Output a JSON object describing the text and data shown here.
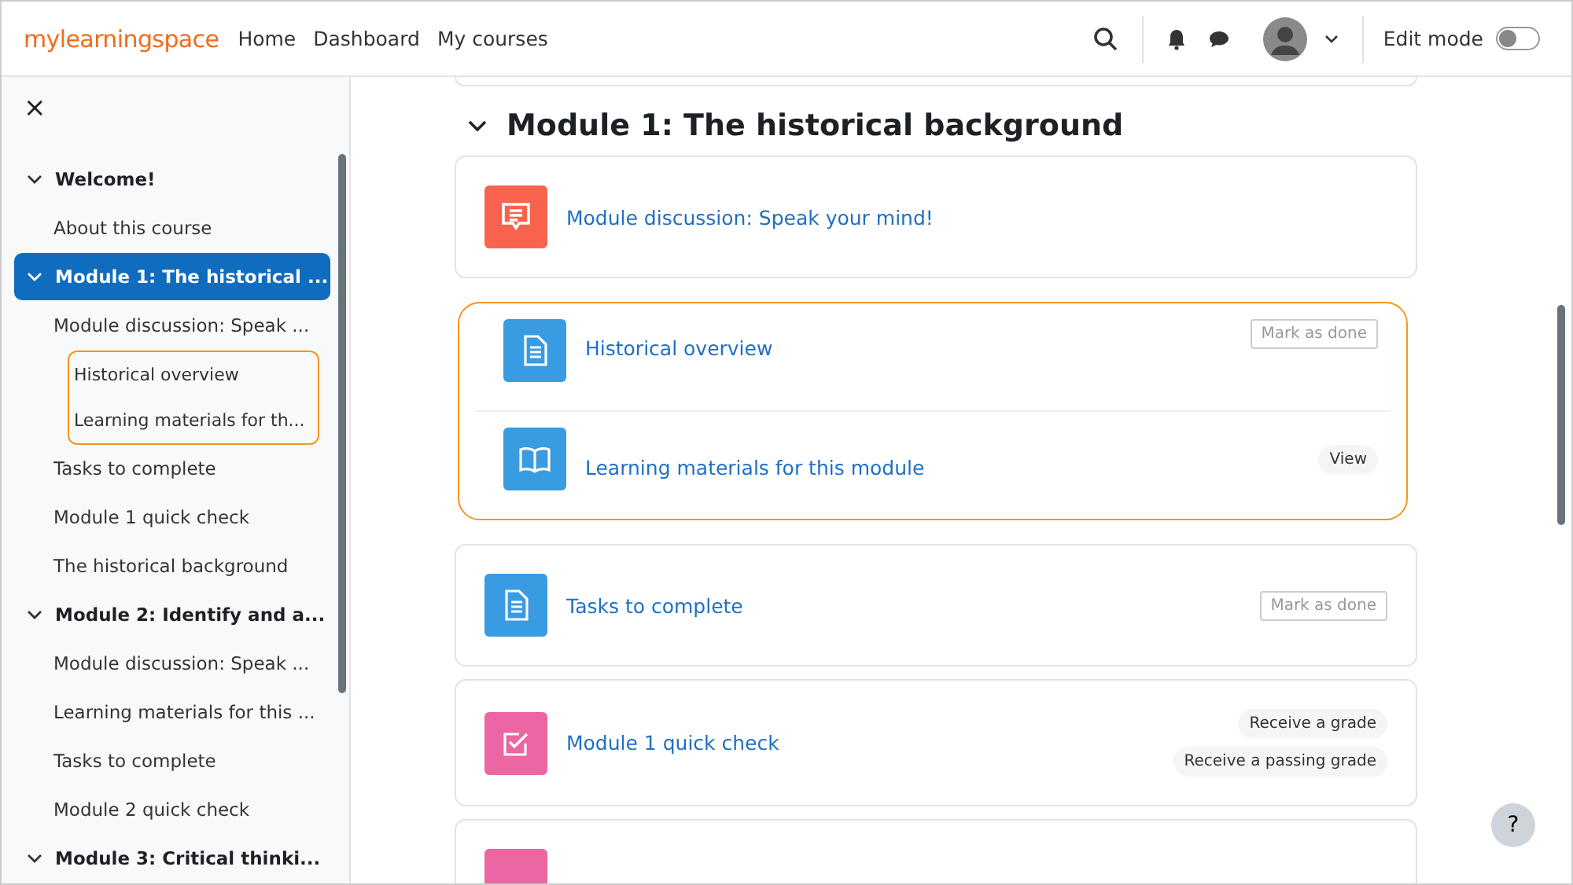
{
  "header": {
    "logo": "mylearningspace",
    "nav": [
      {
        "label": "Home"
      },
      {
        "label": "Dashboard"
      },
      {
        "label": "My courses"
      }
    ],
    "edit_mode": {
      "label": "Edit mode",
      "on": false
    }
  },
  "sidebar": {
    "close": "×",
    "sections": [
      {
        "title": "Welcome!",
        "expanded": true,
        "selected": false,
        "items": [
          {
            "kind": "item",
            "label": "About this course"
          }
        ]
      },
      {
        "title": "Module 1: The historical ...",
        "expanded": true,
        "selected": true,
        "items": [
          {
            "kind": "item",
            "label": "Module discussion: Speak ..."
          },
          {
            "kind": "group",
            "children": [
              {
                "label": "Historical overview"
              },
              {
                "label": "Learning materials for th..."
              }
            ]
          },
          {
            "kind": "item",
            "label": "Tasks to complete"
          },
          {
            "kind": "item",
            "label": "Module 1 quick check"
          },
          {
            "kind": "item",
            "label": "The historical background"
          }
        ]
      },
      {
        "title": "Module 2: Identify and a...",
        "expanded": true,
        "selected": false,
        "items": [
          {
            "kind": "item",
            "label": "Module discussion: Speak ..."
          },
          {
            "kind": "item",
            "label": "Learning materials for this ..."
          },
          {
            "kind": "item",
            "label": "Tasks to complete"
          },
          {
            "kind": "item",
            "label": "Module 2 quick check"
          }
        ]
      },
      {
        "title": "Module 3: Critical thinki...",
        "expanded": true,
        "selected": false
      }
    ]
  },
  "main": {
    "section_title": "Module 1: The historical background",
    "section_expanded": true,
    "blocks": [
      {
        "kind": "card",
        "activities": [
          {
            "kind": "forum",
            "color": "#f7634d",
            "title": "Module discussion: Speak your mind!"
          }
        ]
      },
      {
        "kind": "group",
        "activities": [
          {
            "kind": "page",
            "color": "#399be2",
            "title": "Historical overview",
            "badges": [
              {
                "kind": "button",
                "label": "Mark as done"
              }
            ]
          },
          {
            "kind": "book",
            "color": "#399be2",
            "title": "Learning materials for this module",
            "badges": [
              {
                "kind": "pill",
                "label": "View"
              }
            ]
          }
        ]
      },
      {
        "kind": "card",
        "activities": [
          {
            "kind": "page",
            "color": "#399be2",
            "title": "Tasks to complete",
            "badges": [
              {
                "kind": "button",
                "label": "Mark as done"
              }
            ]
          }
        ]
      },
      {
        "kind": "card",
        "activities": [
          {
            "kind": "quiz",
            "color": "#eb66a2",
            "title": "Module 1 quick check",
            "badges": [
              {
                "kind": "pill",
                "label": "Receive a grade"
              },
              {
                "kind": "pill",
                "label": "Receive a passing grade"
              }
            ]
          }
        ]
      },
      {
        "kind": "card",
        "activities": [
          {
            "kind": "blank",
            "color": "#eb66a2"
          }
        ]
      }
    ]
  },
  "help": "?"
}
